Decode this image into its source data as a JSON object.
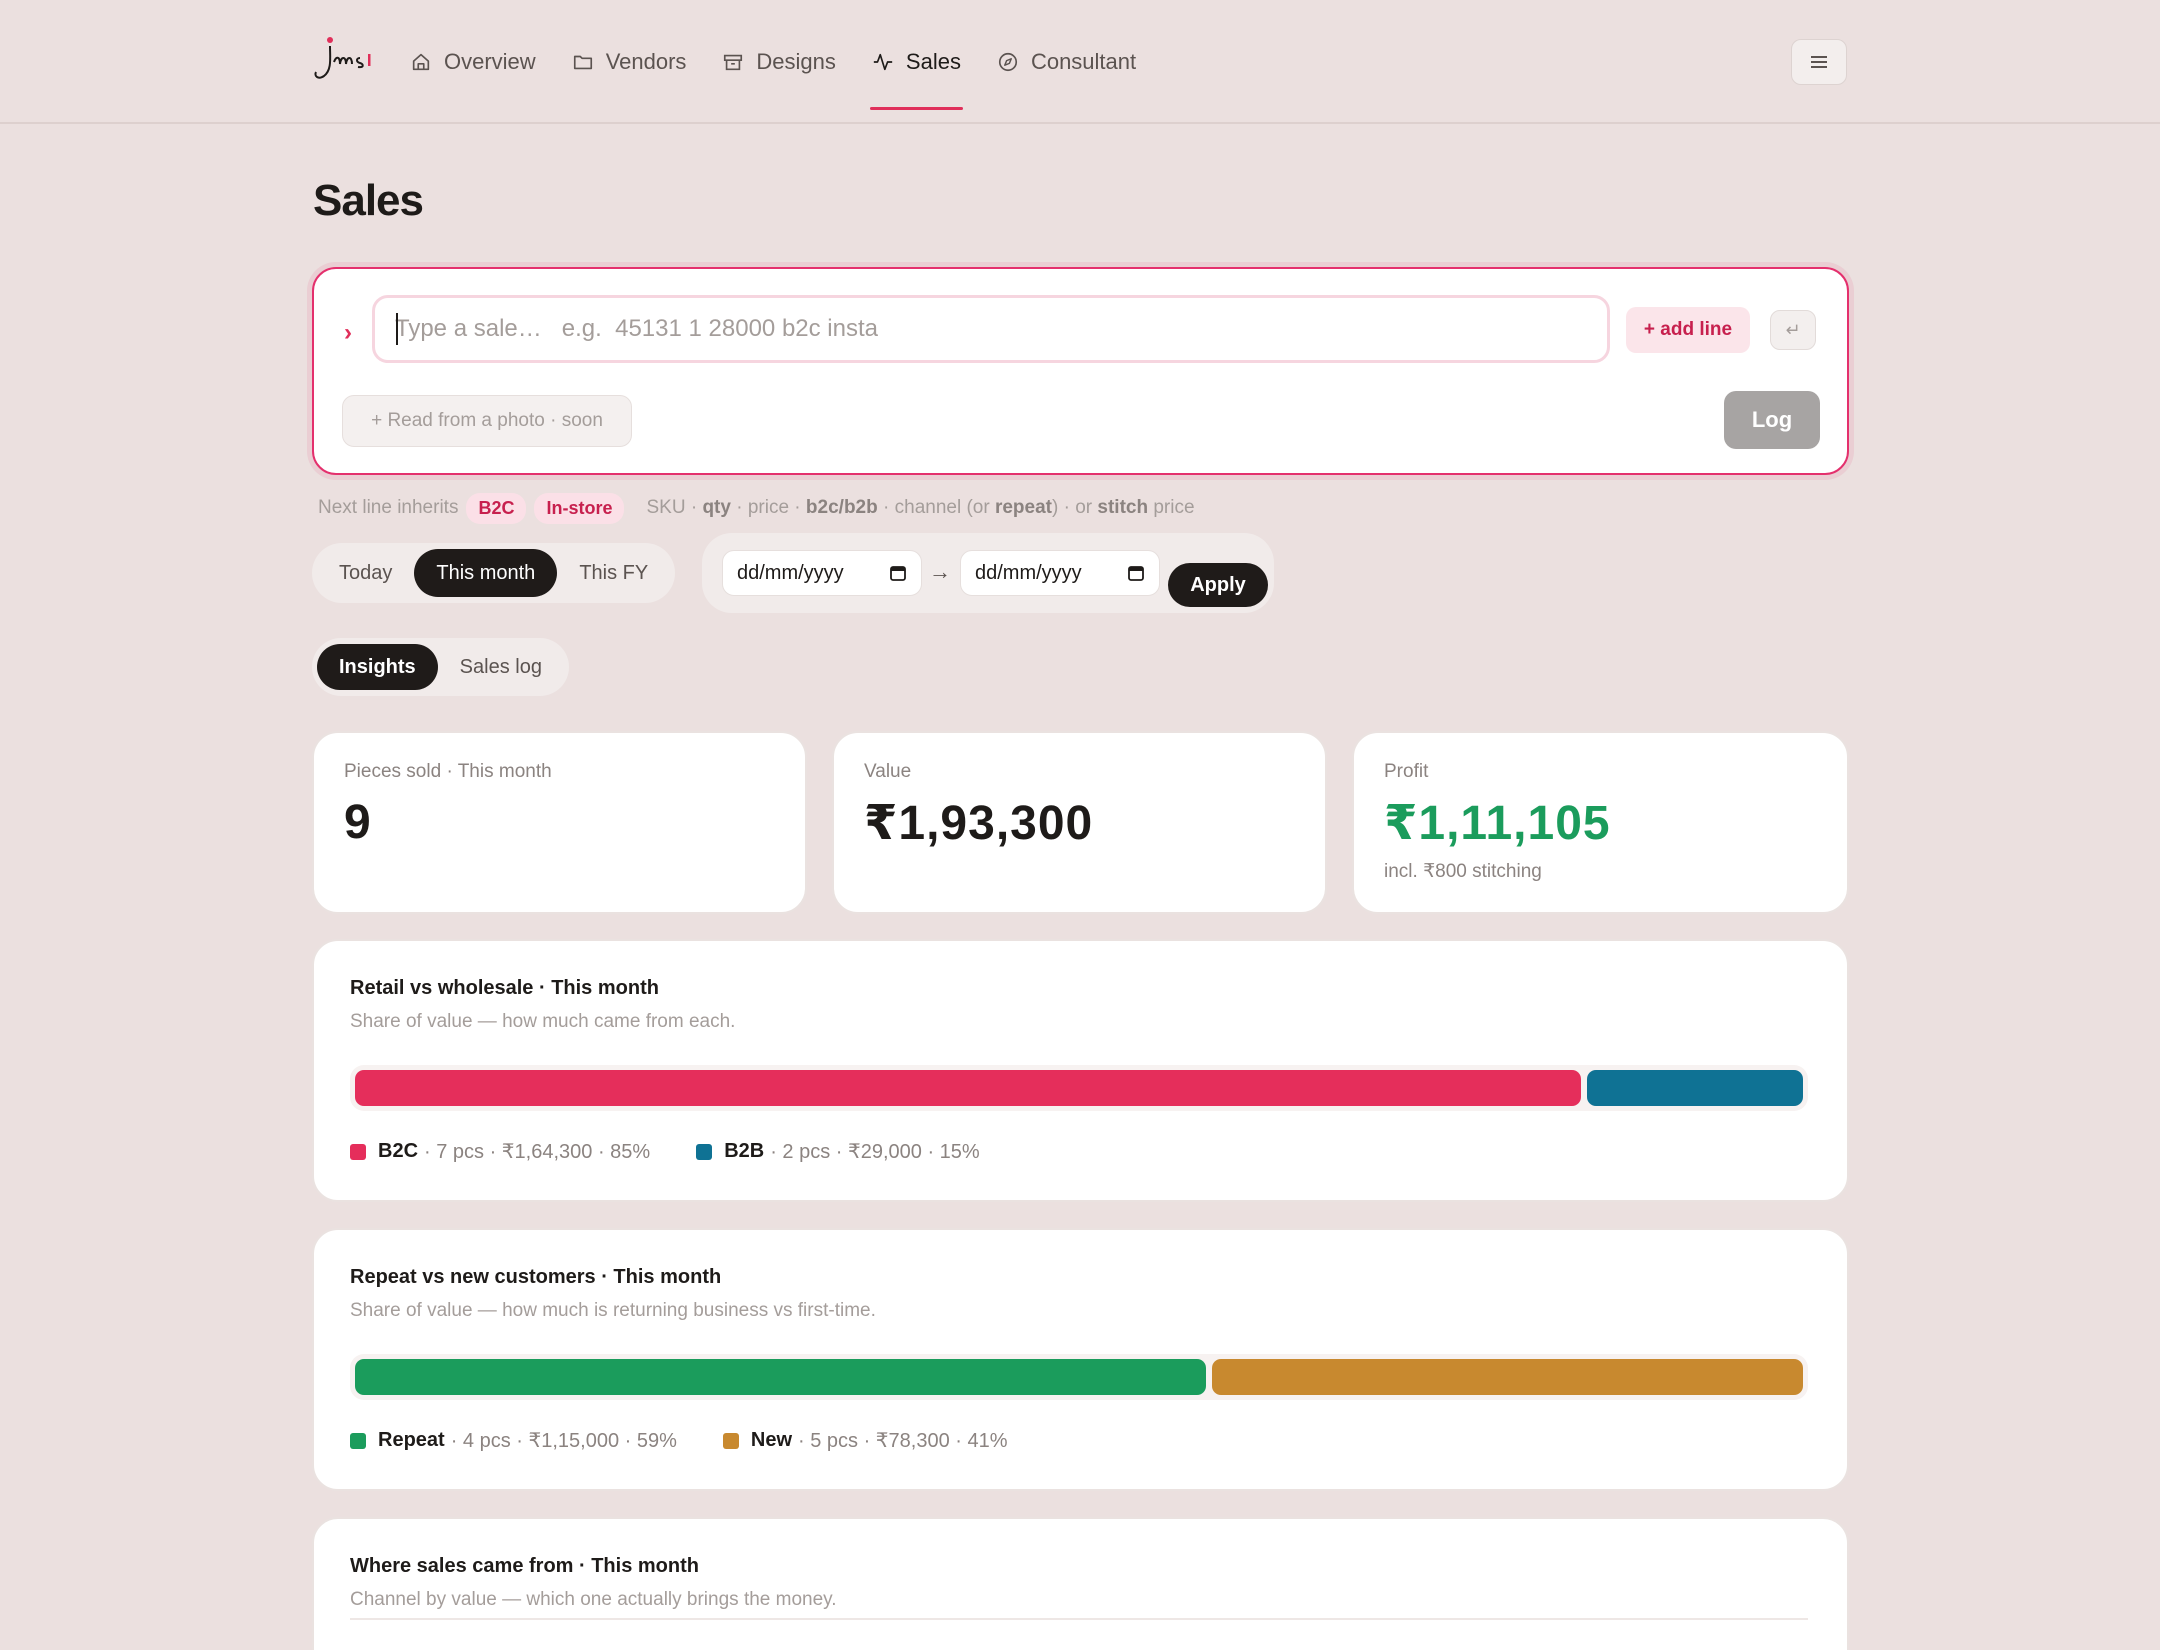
{
  "colors": {
    "accent": "#e02f5a",
    "b2c": "#e52e5b",
    "b2b": "#0f7294",
    "repeat": "#1b9c5c",
    "new": "#c8892f",
    "profit": "#1b9c5c"
  },
  "logo": {
    "icon": "jms-logo",
    "text": "Jms"
  },
  "nav": [
    {
      "label": "Overview",
      "icon": "home-icon"
    },
    {
      "label": "Vendors",
      "icon": "folder-icon"
    },
    {
      "label": "Designs",
      "icon": "archive-icon"
    },
    {
      "label": "Sales",
      "icon": "activity-icon",
      "active": true
    },
    {
      "label": "Consultant",
      "icon": "compass-icon"
    }
  ],
  "header": {
    "menu_icon": "menu-icon"
  },
  "page": {
    "title": "Sales"
  },
  "entry": {
    "prompt": "›",
    "placeholder": "Type a sale…   e.g.  45131 1 28000 b2c insta",
    "add_line_label": "+ add line",
    "enter_label": "↵",
    "photo_label": "+ Read from a photo · soon",
    "log_label": "Log"
  },
  "hint": {
    "prefix": "Next line inherits",
    "chip1": "B2C",
    "chip2": "In-store",
    "sku": "SKU ·",
    "qty": "qty",
    "price": "· price ·",
    "b2c_b2b": "b2c/b2b",
    "channel": "· channel (or",
    "repeat": "repeat",
    "close": ")  ·  or",
    "stitch": "stitch",
    "stitch_price": "price"
  },
  "period_tabs": [
    {
      "label": "Today"
    },
    {
      "label": "This month",
      "active": true
    },
    {
      "label": "This FY"
    }
  ],
  "range": {
    "from_placeholder": "dd/mm/yyyy",
    "to_placeholder": "dd/mm/yyyy",
    "arrow": "→",
    "apply_label": "Apply"
  },
  "view_tabs": [
    {
      "label": "Insights",
      "active": true
    },
    {
      "label": "Sales log"
    }
  ],
  "stats": {
    "pieces": {
      "label": "Pieces sold · This month",
      "value": "9"
    },
    "value": {
      "label": "Value",
      "value": "₹1,93,300"
    },
    "profit": {
      "label": "Profit",
      "value": "₹1,11,105",
      "sub": "incl. ₹800 stitching"
    }
  },
  "retail_wholesale": {
    "title": "Retail vs wholesale · This month",
    "subtitle": "Share of value — how much came from each.",
    "segments": [
      {
        "name": "B2C",
        "detail": "· 7 pcs · ₹1,64,300 · 85%",
        "share": 85
      },
      {
        "name": "B2B",
        "detail": "· 2 pcs · ₹29,000 · 15%",
        "share": 15
      }
    ]
  },
  "repeat_new": {
    "title": "Repeat vs new customers · This month",
    "subtitle": "Share of value — how much is returning business vs first-time.",
    "segments": [
      {
        "name": "Repeat",
        "detail": "· 4 pcs · ₹1,15,000 · 59%",
        "share": 59
      },
      {
        "name": "New",
        "detail": "· 5 pcs · ₹78,300 · 41%",
        "share": 41
      }
    ]
  },
  "channels": {
    "title": "Where sales came from · This month",
    "subtitle": "Channel by value — which one actually brings the money."
  }
}
